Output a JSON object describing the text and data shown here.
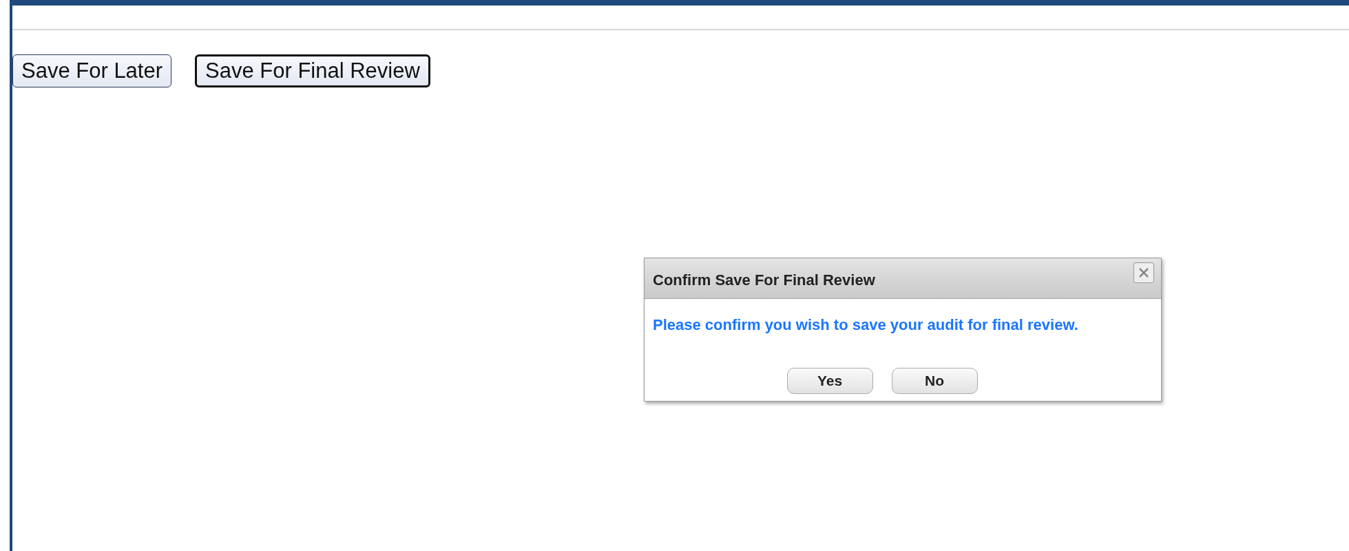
{
  "toolbar": {
    "buttons": [
      {
        "label": "Save For Later",
        "focused": false
      },
      {
        "label": "Save For Final Review",
        "focused": true
      }
    ]
  },
  "dialog": {
    "title": "Confirm Save For Final Review",
    "message": "Please confirm you wish to save your audit for final review.",
    "buttons": [
      "Yes",
      "No"
    ]
  }
}
